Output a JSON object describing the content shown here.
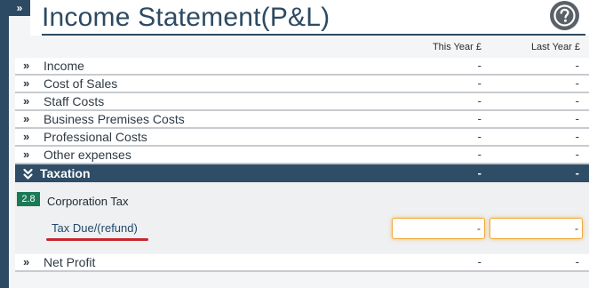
{
  "header": {
    "title": "Income Statement(P&L)",
    "expand_glyph": "»",
    "help_icon": "question-circle-icon"
  },
  "columns": {
    "this_year": "This Year £",
    "last_year": "Last Year £"
  },
  "rows": [
    {
      "label": "Income",
      "this_year": "-",
      "last_year": "-"
    },
    {
      "label": "Cost of Sales",
      "this_year": "-",
      "last_year": "-"
    },
    {
      "label": "Staff Costs",
      "this_year": "-",
      "last_year": "-"
    },
    {
      "label": "Business Premises Costs",
      "this_year": "-",
      "last_year": "-"
    },
    {
      "label": "Professional Costs",
      "this_year": "-",
      "last_year": "-"
    },
    {
      "label": "Other expenses",
      "this_year": "-",
      "last_year": "-"
    }
  ],
  "taxation": {
    "label": "Taxation",
    "this_year": "-",
    "last_year": "-",
    "section_badge": "2.8",
    "section_label": "Corporation Tax",
    "field_label": "Tax Due/(refund)",
    "this_year_value": "-",
    "last_year_value": "-"
  },
  "net_profit": {
    "label": "Net Profit",
    "this_year": "-",
    "last_year": "-"
  },
  "colors": {
    "primary": "#2d4a63",
    "accent_badge": "#1a7a55",
    "highlight": "#c8262b",
    "focus": "#f2a93b"
  }
}
